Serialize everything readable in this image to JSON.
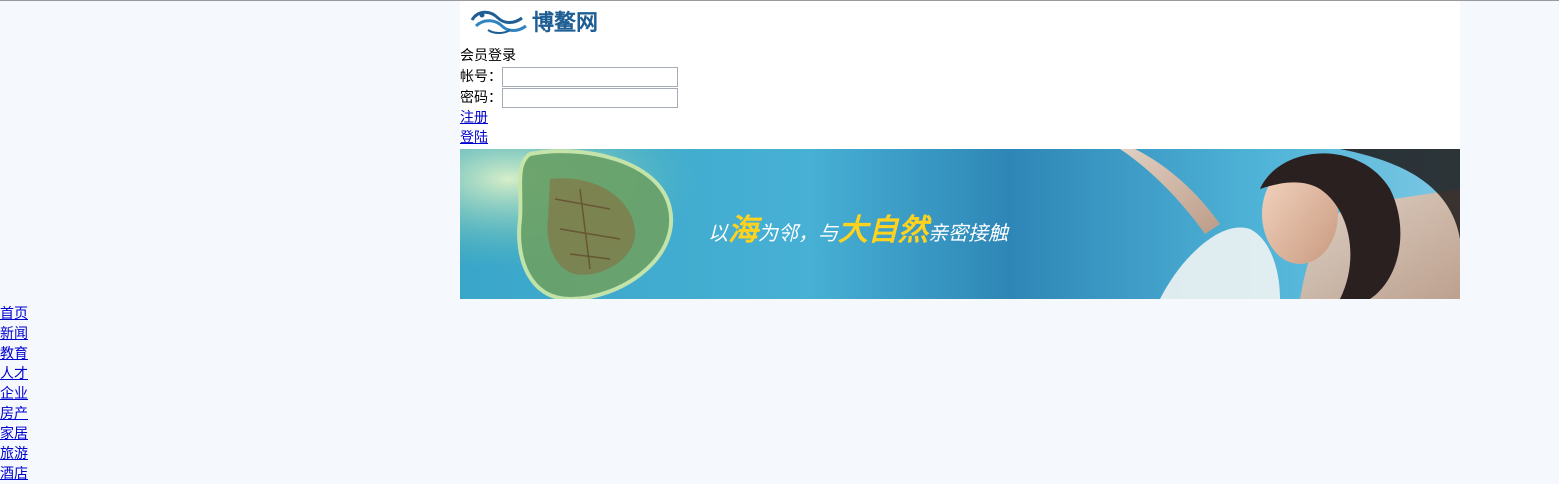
{
  "logo": {
    "text": "博鳌网",
    "icon": "dragon-wave-logo-icon"
  },
  "login": {
    "title": "会员登录",
    "account_label": "帐号：",
    "account_value": "",
    "password_label": "密码：",
    "password_value": "",
    "register_link": "注册",
    "login_link": "登陆"
  },
  "banner": {
    "text_parts": [
      "以",
      "海",
      "为邻，与",
      "大自然",
      "亲密接触"
    ]
  },
  "nav": {
    "items": [
      "首页",
      "新闻",
      "教育",
      "人才",
      "企业",
      "房产",
      "家居",
      "旅游",
      "酒店"
    ]
  },
  "colors": {
    "page_bg": "#f5f9fe",
    "link": "#0000cc",
    "logo": "#1f5e94",
    "banner_highlight": "#ffd21e"
  }
}
